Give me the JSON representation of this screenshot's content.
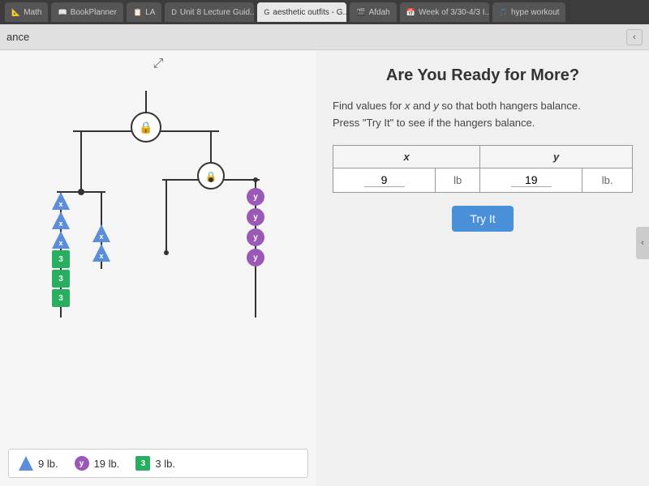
{
  "browser": {
    "tabs": [
      {
        "id": "tab-math",
        "label": "Math",
        "icon": "📐",
        "active": false
      },
      {
        "id": "tab-bookplanner",
        "label": "BookPlanner",
        "icon": "📖",
        "active": false
      },
      {
        "id": "tab-la",
        "label": "LA",
        "icon": "📋",
        "active": false
      },
      {
        "id": "tab-unit8",
        "label": "Unit 8 Lecture Guid...",
        "icon": "D",
        "active": false
      },
      {
        "id": "tab-outfits",
        "label": "aesthetic outfits - G...",
        "icon": "G",
        "active": false
      },
      {
        "id": "tab-afdah",
        "label": "Afdah",
        "icon": "🎬",
        "active": false
      },
      {
        "id": "tab-week",
        "label": "Week of 3/30-4/3 I...",
        "icon": "📅",
        "active": false
      },
      {
        "id": "tab-hype",
        "label": "hype workout",
        "icon": "🎵",
        "active": false
      }
    ]
  },
  "nav": {
    "left_label": "ance",
    "collapse_icon": "‹"
  },
  "page": {
    "title": "Are You Ready for More?",
    "instructions_line1": "Find values for x and y so that both hangers balance.",
    "instructions_line2": "Press \"Try It\" to see if the hangers balance.",
    "expand_icon": "⤢"
  },
  "table": {
    "col_x": "x",
    "col_y": "y",
    "row": {
      "x_value": "9",
      "x_unit": "lb",
      "y_value": "19",
      "y_unit": "lb."
    }
  },
  "try_it_button": "Try It",
  "legend": {
    "x_label": "9 lb.",
    "x_icon": "x",
    "y_label": "19 lb.",
    "y_icon": "y",
    "three_label": "3 lb.",
    "three_icon": "3"
  },
  "hanger": {
    "lock_icon": "🔒",
    "weights": {
      "x_blocks": [
        "x",
        "x",
        "x"
      ],
      "three_blocks": [
        "3",
        "3",
        "3"
      ],
      "x_right_blocks": [
        "x",
        "x"
      ],
      "y_blocks": [
        "y",
        "y",
        "y",
        "y"
      ]
    }
  },
  "colors": {
    "x_blue": "#5b8dd9",
    "y_purple": "#9b59b6",
    "three_green": "#27ae60",
    "try_it_blue": "#4a90d9"
  }
}
